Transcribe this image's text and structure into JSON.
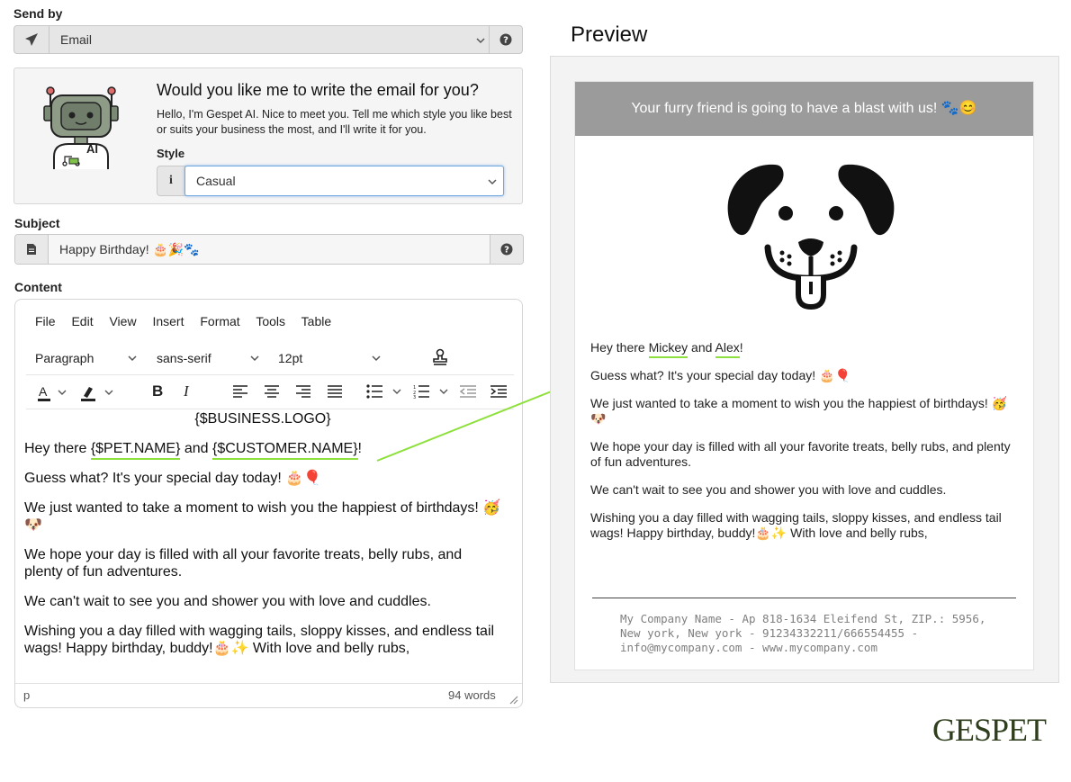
{
  "send_by": {
    "label": "Send by",
    "value": "Email",
    "icon": "paper-plane-icon",
    "help_icon": "question-icon"
  },
  "ai": {
    "title": "Would you like me to write the email for you?",
    "intro": "Hello, I'm Gespet AI. Nice to meet you. Tell me which style you like best or suits your business the most, and I'll write it for you.",
    "style_label": "Style",
    "style_value": "Casual",
    "robot_badge": "AI"
  },
  "subject": {
    "label": "Subject",
    "value": "Happy Birthday! 🎂🎉🐾"
  },
  "content": {
    "label": "Content",
    "menu": [
      "File",
      "Edit",
      "View",
      "Insert",
      "Format",
      "Tools",
      "Table"
    ],
    "block_format": "Paragraph",
    "font_family": "sans-serif",
    "font_size": "12pt",
    "logo_placeholder": "{$BUSINESS.LOGO}",
    "greeting_prefix": "Hey there ",
    "pet_var": "{$PET.NAME}",
    "and": " and ",
    "customer_var": "{$CUSTOMER.NAME}",
    "excl": "!",
    "p2": "Guess what? It's your special day today! 🎂🎈",
    "p3": "We just wanted to take a moment to wish you the happiest of birthdays! 🥳🐶",
    "p4": "We hope your day is filled with all your favorite treats, belly rubs, and plenty of fun adventures.",
    "p5": "We can't wait to see you and shower you with love and cuddles.",
    "p6": "Wishing you a day filled with wagging tails, sloppy kisses, and endless tail wags! Happy birthday, buddy!🎂✨ With love and belly rubs,",
    "status_path": "p",
    "word_count": "94 words"
  },
  "preview": {
    "title": "Preview",
    "header": "Your furry friend is going to have a blast with us! 🐾😊",
    "greeting_prefix": "Hey there ",
    "pet_name": "Mickey",
    "and": " and ",
    "customer_name": "Alex",
    "excl": "!",
    "footer": "My Company Name - Ap 818-1634 Eleifend St, ZIP.: 5956, New york, New york - 91234332211/666554455 - info@mycompany.com - www.mycompany.com"
  },
  "brand": {
    "name": "GESPET"
  },
  "colors": {
    "highlight": "#8ee03c",
    "header_bg": "#9b9b9b",
    "brand": "#2f3e1d"
  }
}
